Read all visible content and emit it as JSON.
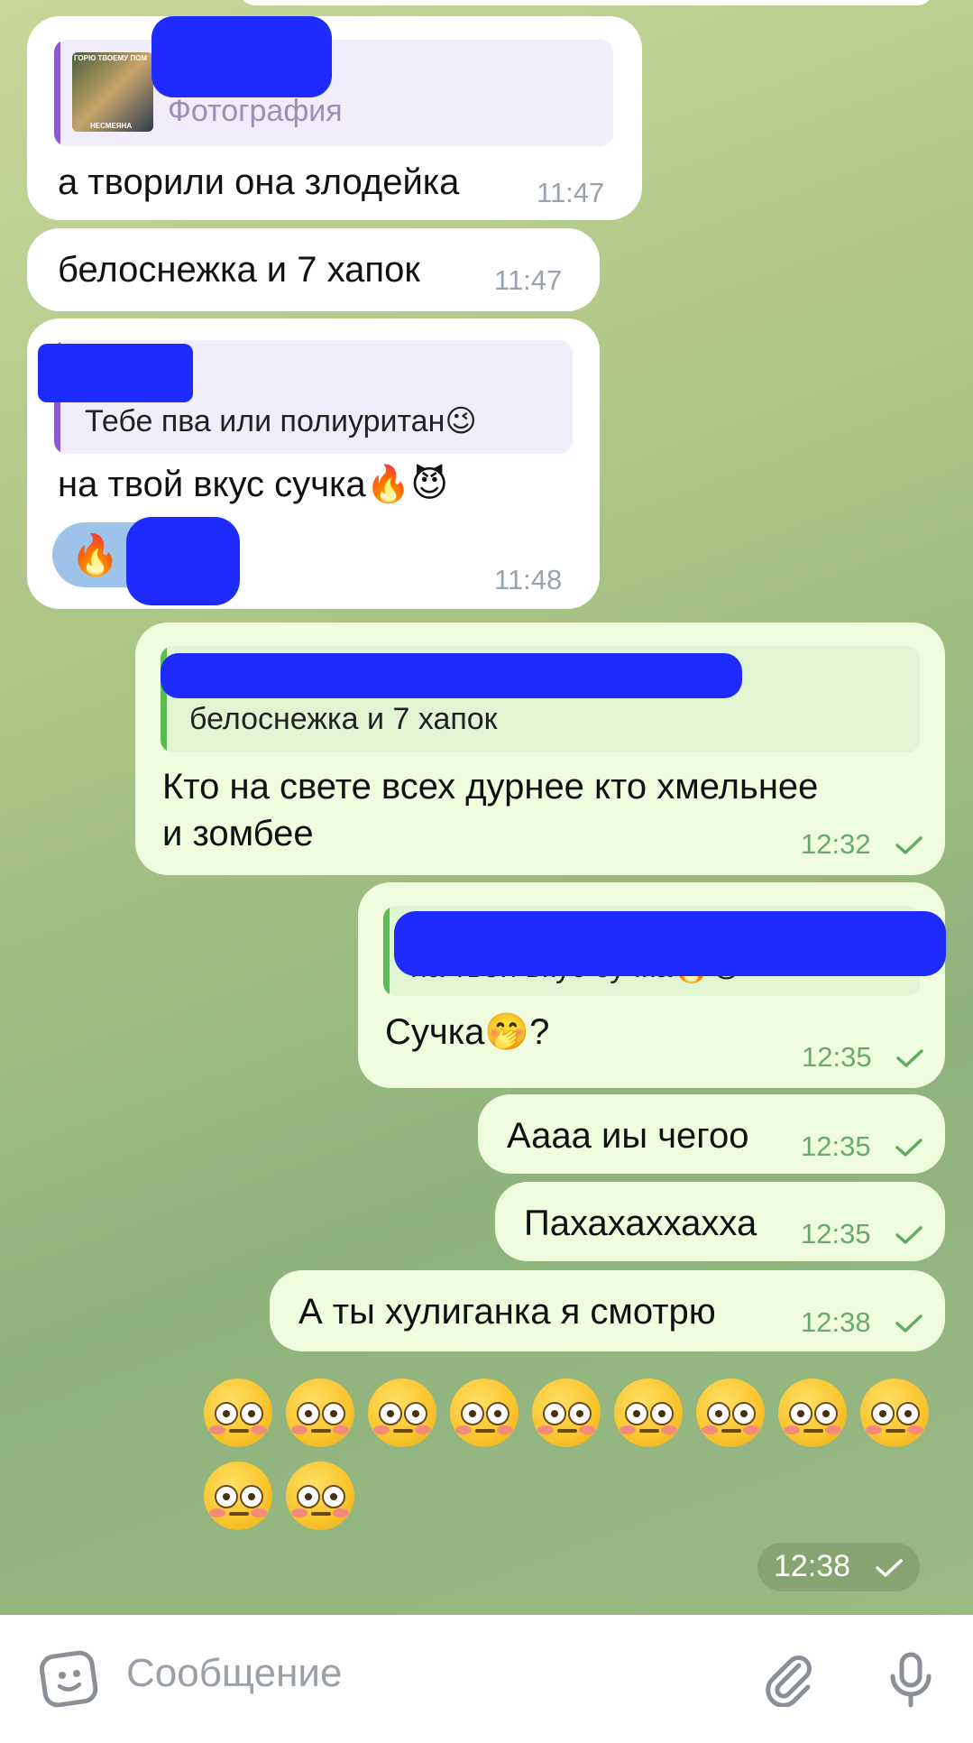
{
  "messages": [
    {
      "id": "m1",
      "side": "in",
      "reply_label": "Фотография",
      "photo_caption_top": "ГОРЮ ТВОЕМУ ПОМ",
      "photo_caption_bottom": "НЕСМЕЯНА",
      "text": "а творили она злодейка",
      "time": "11:47"
    },
    {
      "id": "m2",
      "side": "in",
      "text": "белоснежка и 7 хапок",
      "time": "11:47"
    },
    {
      "id": "m3",
      "side": "in",
      "reply_text": "Тебе пва или полиуритан😉",
      "text": "на твой вкус сучка🔥😈",
      "reaction": "🔥",
      "time": "11:48"
    },
    {
      "id": "m4",
      "side": "out",
      "reply_text": "белоснежка и 7 хапок",
      "text_line1": "Кто на свете всех дурнее кто хмельнее",
      "text_line2": "и зомбее",
      "time": "12:32"
    },
    {
      "id": "m5",
      "side": "out",
      "reply_text": "на твой вкус сучка🔥😈",
      "text": "Сучка🤭?",
      "time": "12:35"
    },
    {
      "id": "m6",
      "side": "out",
      "text": "Аааа иы чегоо",
      "time": "12:35"
    },
    {
      "id": "m7",
      "side": "out",
      "text": "Пахахаххахха",
      "time": "12:35"
    },
    {
      "id": "m8",
      "side": "out",
      "text": "А ты хулиганка я смотрю",
      "time": "12:38"
    }
  ],
  "emoji_message": {
    "emoji": "😳",
    "count": 11,
    "time": "12:38"
  },
  "composer": {
    "placeholder": "Сообщение"
  },
  "colors": {
    "out_bubble": "#effdde",
    "in_bubble": "#ffffff",
    "check": "#5fae5f"
  }
}
